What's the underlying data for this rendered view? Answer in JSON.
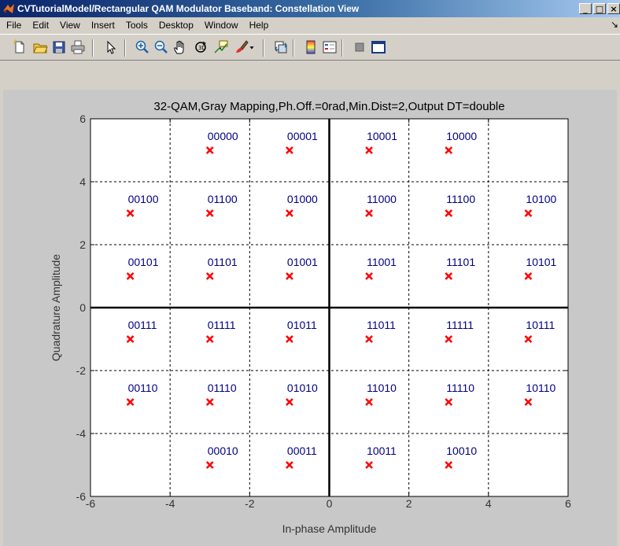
{
  "window": {
    "title": "CVTutorialModel/Rectangular QAM Modulator Baseband: Constellation View",
    "minimize_label": "_",
    "maximize_label": "□",
    "close_label": "×"
  },
  "menu": [
    "File",
    "Edit",
    "View",
    "Insert",
    "Tools",
    "Desktop",
    "Window",
    "Help"
  ],
  "menu_overflow_label": "↘",
  "toolbar": {
    "tools": [
      "new-figure",
      "open-file",
      "save",
      "print",
      "edit-plot",
      "zoom-in",
      "zoom-out",
      "pan",
      "rotate-3d",
      "data-cursor",
      "brush",
      "brush-menu",
      "link-plot",
      "colorbar",
      "legend",
      "hide-plot-tools",
      "show-plot-tools"
    ]
  },
  "colors": {
    "marker": "#ff0000",
    "label": "#000080",
    "axes_bg": "#ffffff",
    "figure_bg": "#c8c8c8"
  },
  "chart_data": {
    "type": "scatter",
    "title": "32-QAM,Gray Mapping,Ph.Off.=0rad,Min.Dist=2,Output DT=double",
    "xlabel": "In-phase Amplitude",
    "ylabel": "Quadrature Amplitude",
    "xlim": [
      -6,
      6
    ],
    "ylim": [
      -6,
      6
    ],
    "xticks": [
      -6,
      -4,
      -2,
      0,
      2,
      4,
      6
    ],
    "yticks": [
      -6,
      -4,
      -2,
      0,
      2,
      4,
      6
    ],
    "xtick_labels": [
      "-6",
      "-4",
      "-2",
      "0",
      "2",
      "4",
      "6"
    ],
    "ytick_labels": [
      "-6",
      "-4",
      "-2",
      "0",
      "2",
      "4",
      "6"
    ],
    "grid": true,
    "marker": "x",
    "points": [
      {
        "x": -3,
        "y": 5,
        "label": "00000"
      },
      {
        "x": -1,
        "y": 5,
        "label": "00001"
      },
      {
        "x": 1,
        "y": 5,
        "label": "10001"
      },
      {
        "x": 3,
        "y": 5,
        "label": "10000"
      },
      {
        "x": -5,
        "y": 3,
        "label": "00100"
      },
      {
        "x": -3,
        "y": 3,
        "label": "01100"
      },
      {
        "x": -1,
        "y": 3,
        "label": "01000"
      },
      {
        "x": 1,
        "y": 3,
        "label": "11000"
      },
      {
        "x": 3,
        "y": 3,
        "label": "11100"
      },
      {
        "x": 5,
        "y": 3,
        "label": "10100"
      },
      {
        "x": -5,
        "y": 1,
        "label": "00101"
      },
      {
        "x": -3,
        "y": 1,
        "label": "01101"
      },
      {
        "x": -1,
        "y": 1,
        "label": "01001"
      },
      {
        "x": 1,
        "y": 1,
        "label": "11001"
      },
      {
        "x": 3,
        "y": 1,
        "label": "11101"
      },
      {
        "x": 5,
        "y": 1,
        "label": "10101"
      },
      {
        "x": -5,
        "y": -1,
        "label": "00111"
      },
      {
        "x": -3,
        "y": -1,
        "label": "01111"
      },
      {
        "x": -1,
        "y": -1,
        "label": "01011"
      },
      {
        "x": 1,
        "y": -1,
        "label": "11011"
      },
      {
        "x": 3,
        "y": -1,
        "label": "11111"
      },
      {
        "x": 5,
        "y": -1,
        "label": "10111"
      },
      {
        "x": -5,
        "y": -3,
        "label": "00110"
      },
      {
        "x": -3,
        "y": -3,
        "label": "01110"
      },
      {
        "x": -1,
        "y": -3,
        "label": "01010"
      },
      {
        "x": 1,
        "y": -3,
        "label": "11010"
      },
      {
        "x": 3,
        "y": -3,
        "label": "11110"
      },
      {
        "x": 5,
        "y": -3,
        "label": "10110"
      },
      {
        "x": -3,
        "y": -5,
        "label": "00010"
      },
      {
        "x": -1,
        "y": -5,
        "label": "00011"
      },
      {
        "x": 1,
        "y": -5,
        "label": "10011"
      },
      {
        "x": 3,
        "y": -5,
        "label": "10010"
      }
    ]
  }
}
